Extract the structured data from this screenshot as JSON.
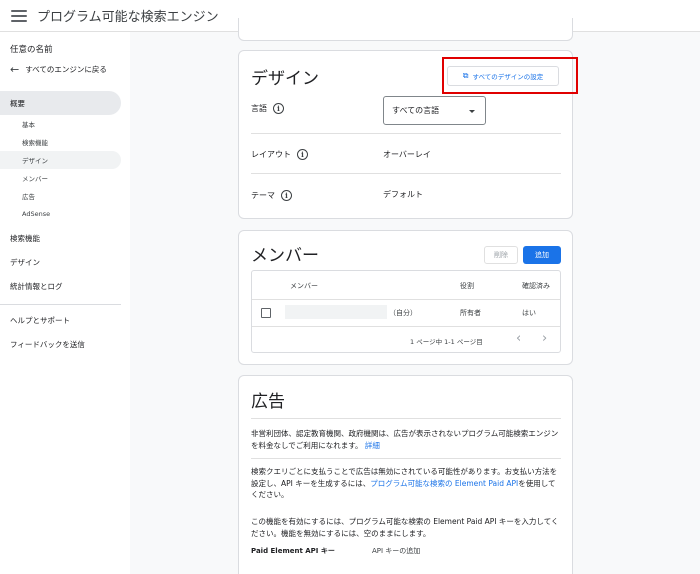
{
  "header": {
    "title": "プログラム可能な検索エンジン"
  },
  "sidebar": {
    "heading": "任意の名前",
    "back_label": "すべてのエンジンに戻る",
    "overview": "概要",
    "sub_items": [
      "基本",
      "検索機能",
      "デザイン",
      "メンバー",
      "広告",
      "AdSense"
    ],
    "items": [
      "検索機能",
      "デザイン",
      "統計情報とログ"
    ],
    "bottom_items": [
      "ヘルプとサポート",
      "フィードバックを送信"
    ]
  },
  "design": {
    "title": "デザイン",
    "settings_button": "すべてのデザインの設定",
    "language_label": "言語",
    "language_value": "すべての言語",
    "layout_label": "レイアウト",
    "layout_value": "オーバーレイ",
    "theme_label": "テーマ",
    "theme_value": "デフォルト"
  },
  "members": {
    "title": "メンバー",
    "delete_button": "削除",
    "add_button": "追加",
    "columns": [
      "メンバー",
      "役割",
      "確認済み"
    ],
    "rows": [
      {
        "suffix": "（自分）",
        "role": "所有者",
        "verified": "はい"
      }
    ],
    "pagination": "1 ページ中 1-1 ページ目"
  },
  "ads": {
    "title": "広告",
    "para1": "非営利団体、認定教育機関、政府機関は、広告が表示されないプログラム可能検索エンジンを料金なしでご利用になれます。",
    "para1_link": "詳細",
    "para2_before": "検索クエリごとに支払うことで広告は無効にされている可能性があります。お支払い方法を設定し、API キーを生成するには、",
    "para2_link": "プログラム可能な検索の Element Paid API",
    "para2_after": "を使用してください。",
    "para3": "この機能を有効にするには、プログラム可能な検索の Element Paid API キーを入力してください。機能を無効にするには、空のままにします。",
    "api_key_label": "Paid Element API キー",
    "api_key_value": "API キーの追加"
  },
  "colors": {
    "accent": "#1a73e8",
    "highlight": "#e00000"
  }
}
